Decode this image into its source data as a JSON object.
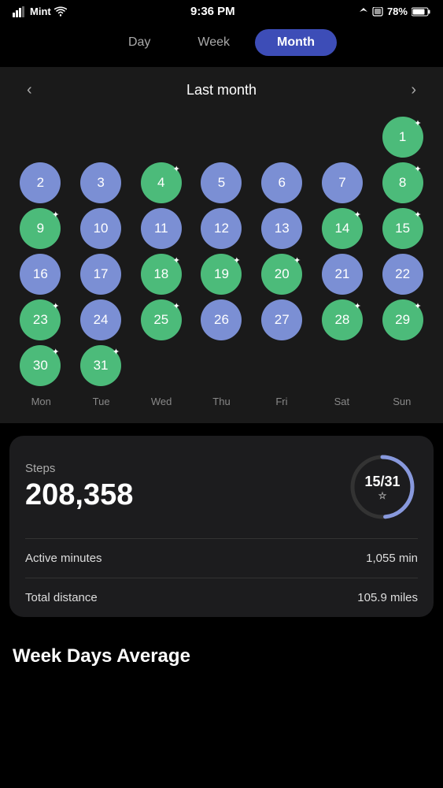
{
  "statusBar": {
    "carrier": "Mint",
    "time": "9:36 PM",
    "location": "↗",
    "sim": "▭",
    "battery": "78%"
  },
  "tabs": [
    {
      "id": "day",
      "label": "Day",
      "active": false
    },
    {
      "id": "week",
      "label": "Week",
      "active": false
    },
    {
      "id": "month",
      "label": "Month",
      "active": true
    }
  ],
  "calendar": {
    "title": "Last month",
    "days": [
      {
        "num": "",
        "type": "empty",
        "star": false
      },
      {
        "num": "",
        "type": "empty",
        "star": false
      },
      {
        "num": "",
        "type": "empty",
        "star": false
      },
      {
        "num": "",
        "type": "empty",
        "star": false
      },
      {
        "num": "",
        "type": "empty",
        "star": false
      },
      {
        "num": "",
        "type": "empty",
        "star": false
      },
      {
        "num": "1",
        "type": "green",
        "star": true
      },
      {
        "num": "2",
        "type": "blue",
        "star": false
      },
      {
        "num": "3",
        "type": "blue",
        "star": false
      },
      {
        "num": "4",
        "type": "green",
        "star": true
      },
      {
        "num": "5",
        "type": "blue",
        "star": false
      },
      {
        "num": "6",
        "type": "blue",
        "star": false
      },
      {
        "num": "7",
        "type": "blue",
        "star": false
      },
      {
        "num": "8",
        "type": "green",
        "star": true
      },
      {
        "num": "9",
        "type": "green",
        "star": true
      },
      {
        "num": "10",
        "type": "blue",
        "star": false
      },
      {
        "num": "11",
        "type": "blue",
        "star": false
      },
      {
        "num": "12",
        "type": "blue",
        "star": false
      },
      {
        "num": "13",
        "type": "blue",
        "star": false
      },
      {
        "num": "14",
        "type": "green",
        "star": true
      },
      {
        "num": "15",
        "type": "green",
        "star": true
      },
      {
        "num": "16",
        "type": "blue",
        "star": false
      },
      {
        "num": "17",
        "type": "blue",
        "star": false
      },
      {
        "num": "18",
        "type": "green",
        "star": true
      },
      {
        "num": "19",
        "type": "green",
        "star": true
      },
      {
        "num": "20",
        "type": "green",
        "star": true
      },
      {
        "num": "21",
        "type": "blue",
        "star": false
      },
      {
        "num": "22",
        "type": "blue",
        "star": false
      },
      {
        "num": "23",
        "type": "green",
        "star": true
      },
      {
        "num": "24",
        "type": "blue",
        "star": false
      },
      {
        "num": "25",
        "type": "green",
        "star": true
      },
      {
        "num": "26",
        "type": "blue",
        "star": false
      },
      {
        "num": "27",
        "type": "blue",
        "star": false
      },
      {
        "num": "28",
        "type": "green",
        "star": true
      },
      {
        "num": "29",
        "type": "green",
        "star": true
      },
      {
        "num": "30",
        "type": "green",
        "star": true
      },
      {
        "num": "31",
        "type": "green",
        "star": true
      },
      {
        "num": "",
        "type": "empty",
        "star": false
      },
      {
        "num": "",
        "type": "empty",
        "star": false
      },
      {
        "num": "",
        "type": "empty",
        "star": false
      },
      {
        "num": "",
        "type": "empty",
        "star": false
      },
      {
        "num": "",
        "type": "empty",
        "star": false
      }
    ],
    "dayLabels": [
      "Mon",
      "Tue",
      "Wed",
      "Thu",
      "Fri",
      "Sat",
      "Sun"
    ]
  },
  "stats": {
    "stepsLabel": "Steps",
    "stepsValue": "208,358",
    "progressCurrent": 15,
    "progressTotal": 31,
    "progressDisplay": "15/31",
    "activeMinutesLabel": "Active minutes",
    "activeMinutesValue": "1,055 min",
    "totalDistanceLabel": "Total distance",
    "totalDistanceValue": "105.9 miles"
  },
  "weekAvg": {
    "title": "Week Days Average"
  }
}
